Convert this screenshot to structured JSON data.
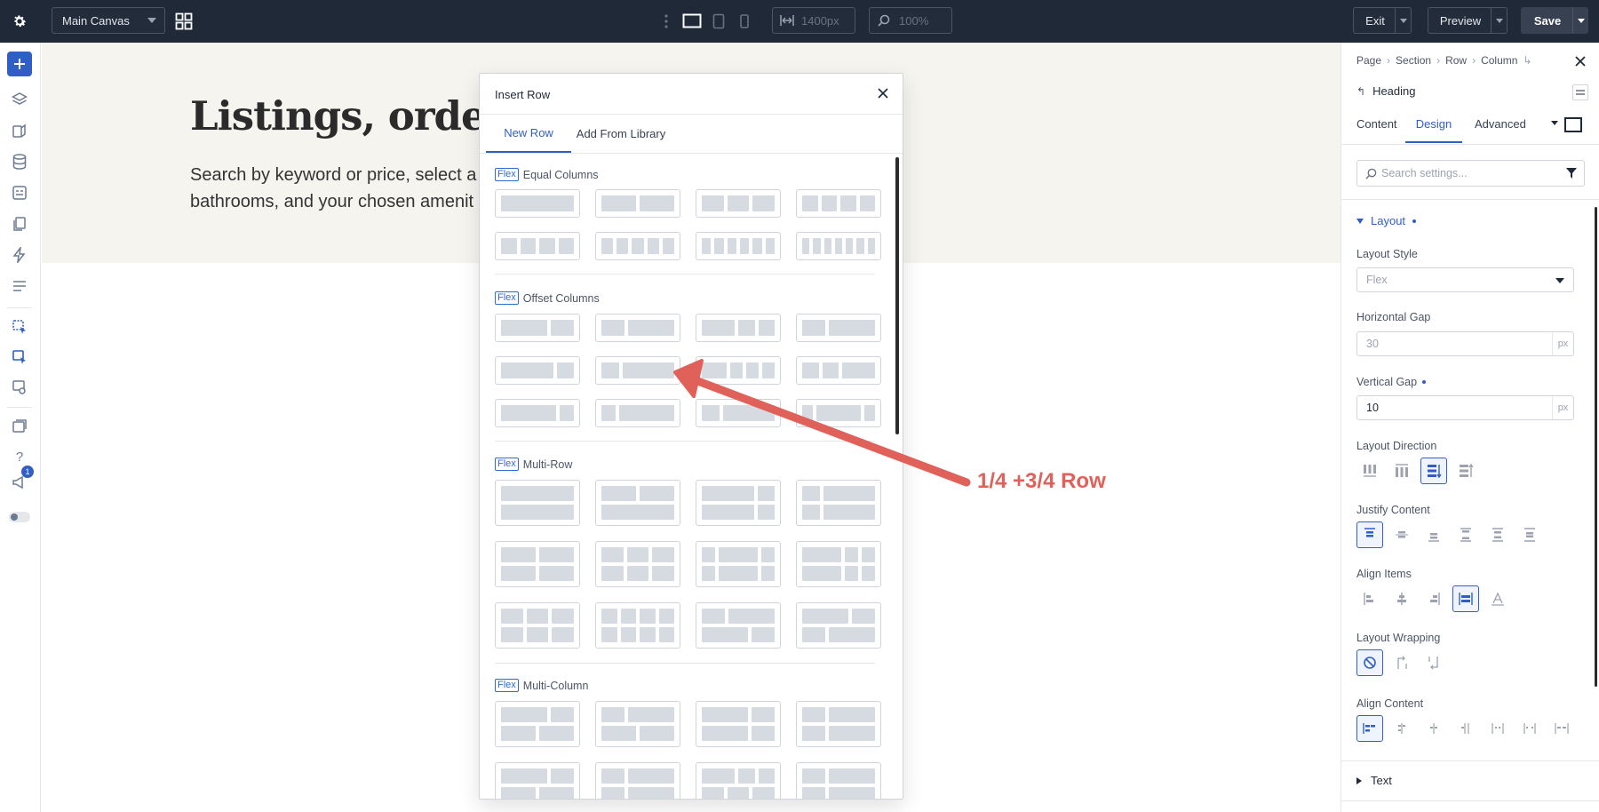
{
  "topbar": {
    "canvas_select": "Main Canvas",
    "width_value": "1400px",
    "zoom_value": "100%",
    "exit_label": "Exit",
    "preview_label": "Preview",
    "save_label": "Save"
  },
  "leftbar": {
    "notification_count": "1"
  },
  "hero": {
    "heading": "Listings, ordered",
    "body_line1": "Search by keyword or price, select a",
    "body_line2": "bathrooms, and your chosen amenit"
  },
  "modal": {
    "title": "Insert Row",
    "tabs": [
      {
        "label": "New Row",
        "active": true
      },
      {
        "label": "Add From Library",
        "active": false
      }
    ],
    "sections": [
      {
        "badge": "Flex",
        "title": "Equal Columns"
      },
      {
        "badge": "Flex",
        "title": "Offset Columns"
      },
      {
        "badge": "Flex",
        "title": "Multi-Row"
      },
      {
        "badge": "Flex",
        "title": "Multi-Column"
      }
    ]
  },
  "annotation": {
    "label": "1/4 +3/4 Row",
    "color": "#e0605a"
  },
  "panel": {
    "breadcrumb": [
      "Page",
      "Section",
      "Row",
      "Column"
    ],
    "element_title": "Heading",
    "tabs": [
      {
        "label": "Content",
        "active": false
      },
      {
        "label": "Design",
        "active": true
      },
      {
        "label": "Advanced",
        "active": false
      }
    ],
    "search_placeholder": "Search settings...",
    "group_title": "Layout",
    "layout_style_label": "Layout Style",
    "layout_style_value": "Flex",
    "hgap_label": "Horizontal Gap",
    "hgap_placeholder": "30",
    "hgap_unit": "px",
    "vgap_label": "Vertical Gap",
    "vgap_value": "10",
    "vgap_unit": "px",
    "direction_label": "Layout Direction",
    "justify_label": "Justify Content",
    "align_items_label": "Align Items",
    "wrapping_label": "Layout Wrapping",
    "align_content_label": "Align Content",
    "text_group": "Text"
  },
  "colors": {
    "accent": "#2f5fc4",
    "topbar": "#1f2937",
    "hero_bg": "#f6f4ef"
  }
}
